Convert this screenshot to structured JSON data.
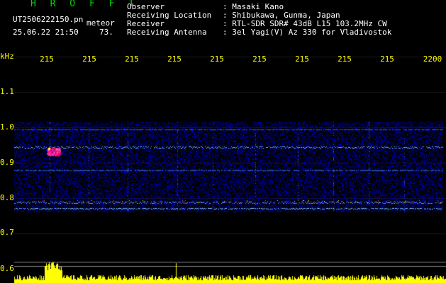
{
  "header": {
    "app_title": "H R O F F T",
    "file_name": "UT2506222150.pn",
    "meteor_label": "meteor",
    "date_time": "25.06.22 21:50",
    "count": "73.",
    "info": [
      {
        "key": "Observer",
        "value": ": Masaki Kano"
      },
      {
        "key": "Receiving Location",
        "value": ": Shibukawa, Gunma, Japan"
      },
      {
        "key": "Receiver",
        "value": ": RTL-SDR SDR# 43dB L15 103.2MHz CW"
      },
      {
        "key": "Receiving Antenna",
        "value": ": 3el Yagi(V) Az 330 for Vladivostok"
      }
    ]
  },
  "axes": {
    "unit": "kHz",
    "x_ticks": [
      "215",
      "215",
      "215",
      "215",
      "215",
      "215",
      "215",
      "215",
      "215",
      "2200"
    ],
    "y_ticks": [
      "1.1",
      "1.0",
      "0.9",
      "0.8",
      "0.7",
      "0.6"
    ]
  },
  "colors": {
    "background": "#000000",
    "header_text": "#ffffff",
    "app_title": "#00d800",
    "tick_label": "#ffff00",
    "spectrogram_base": "#0000c8",
    "signal_hot": "#ff0080",
    "histogram": "#ffff00"
  }
}
